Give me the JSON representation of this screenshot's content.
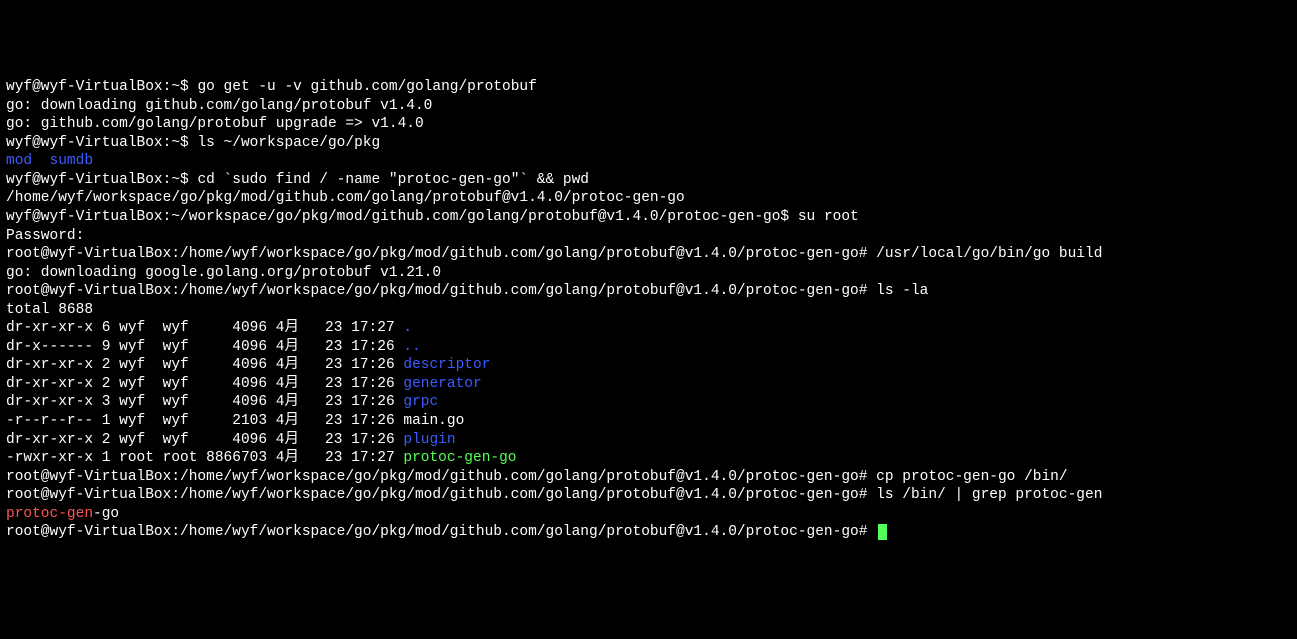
{
  "lines": {
    "l1": {
      "prompt": "wyf@wyf-VirtualBox:~$ ",
      "cmd": "go get -u -v github.com/golang/protobuf"
    },
    "l2": "go: downloading github.com/golang/protobuf v1.4.0",
    "l3": "go: github.com/golang/protobuf upgrade => v1.4.0",
    "l4": {
      "prompt": "wyf@wyf-VirtualBox:~$ ",
      "cmd": "ls ~/workspace/go/pkg"
    },
    "l5": {
      "a": "mod",
      "sp": "  ",
      "b": "sumdb"
    },
    "l6": {
      "prompt": "wyf@wyf-VirtualBox:~$ ",
      "cmd": "cd `sudo find / -name \"protoc-gen-go\"` && pwd"
    },
    "l7": "/home/wyf/workspace/go/pkg/mod/github.com/golang/protobuf@v1.4.0/protoc-gen-go",
    "l8": {
      "prompt": "wyf@wyf-VirtualBox:~/workspace/go/pkg/mod/github.com/golang/protobuf@v1.4.0/protoc-gen-go$ ",
      "cmd": "su root"
    },
    "l9": "Password:",
    "l10": {
      "prompt": "root@wyf-VirtualBox:/home/wyf/workspace/go/pkg/mod/github.com/golang/protobuf@v1.4.0/protoc-gen-go# ",
      "cmd": "/usr/local/go/bin/go build"
    },
    "l11": "go: downloading google.golang.org/protobuf v1.21.0",
    "l12": {
      "prompt": "root@wyf-VirtualBox:/home/wyf/workspace/go/pkg/mod/github.com/golang/protobuf@v1.4.0/protoc-gen-go# ",
      "cmd": "ls -la"
    },
    "l13": "total 8688",
    "ls_rows": [
      {
        "perm": "dr-xr-xr-x",
        "lnk": "6",
        "own": "wyf ",
        "grp": "wyf ",
        "size": "   4096",
        "mon": "4月",
        "day": "  23",
        "time": "17:27",
        "name": ".",
        "cls": "c-blue"
      },
      {
        "perm": "dr-x------",
        "lnk": "9",
        "own": "wyf ",
        "grp": "wyf ",
        "size": "   4096",
        "mon": "4月",
        "day": "  23",
        "time": "17:26",
        "name": "..",
        "cls": "c-blue"
      },
      {
        "perm": "dr-xr-xr-x",
        "lnk": "2",
        "own": "wyf ",
        "grp": "wyf ",
        "size": "   4096",
        "mon": "4月",
        "day": "  23",
        "time": "17:26",
        "name": "descriptor",
        "cls": "c-blue"
      },
      {
        "perm": "dr-xr-xr-x",
        "lnk": "2",
        "own": "wyf ",
        "grp": "wyf ",
        "size": "   4096",
        "mon": "4月",
        "day": "  23",
        "time": "17:26",
        "name": "generator",
        "cls": "c-blue"
      },
      {
        "perm": "dr-xr-xr-x",
        "lnk": "3",
        "own": "wyf ",
        "grp": "wyf ",
        "size": "   4096",
        "mon": "4月",
        "day": "  23",
        "time": "17:26",
        "name": "grpc",
        "cls": "c-blue"
      },
      {
        "perm": "-r--r--r--",
        "lnk": "1",
        "own": "wyf ",
        "grp": "wyf ",
        "size": "   2103",
        "mon": "4月",
        "day": "  23",
        "time": "17:26",
        "name": "main.go",
        "cls": "c-white"
      },
      {
        "perm": "dr-xr-xr-x",
        "lnk": "2",
        "own": "wyf ",
        "grp": "wyf ",
        "size": "   4096",
        "mon": "4月",
        "day": "  23",
        "time": "17:26",
        "name": "plugin",
        "cls": "c-blue"
      },
      {
        "perm": "-rwxr-xr-x",
        "lnk": "1",
        "own": "root",
        "grp": "root",
        "size": "8866703",
        "mon": "4月",
        "day": "  23",
        "time": "17:27",
        "name": "protoc-gen-go",
        "cls": "c-green"
      }
    ],
    "l22": {
      "prompt": "root@wyf-VirtualBox:/home/wyf/workspace/go/pkg/mod/github.com/golang/protobuf@v1.4.0/protoc-gen-go# ",
      "cmd": "cp protoc-gen-go /bin/"
    },
    "l23": {
      "prompt": "root@wyf-VirtualBox:/home/wyf/workspace/go/pkg/mod/github.com/golang/protobuf@v1.4.0/protoc-gen-go# ",
      "cmd": "ls /bin/ | grep protoc-gen"
    },
    "l24": {
      "a": "protoc-gen",
      "b": "-go"
    },
    "l25": {
      "prompt": "root@wyf-VirtualBox:/home/wyf/workspace/go/pkg/mod/github.com/golang/protobuf@v1.4.0/protoc-gen-go# "
    }
  }
}
